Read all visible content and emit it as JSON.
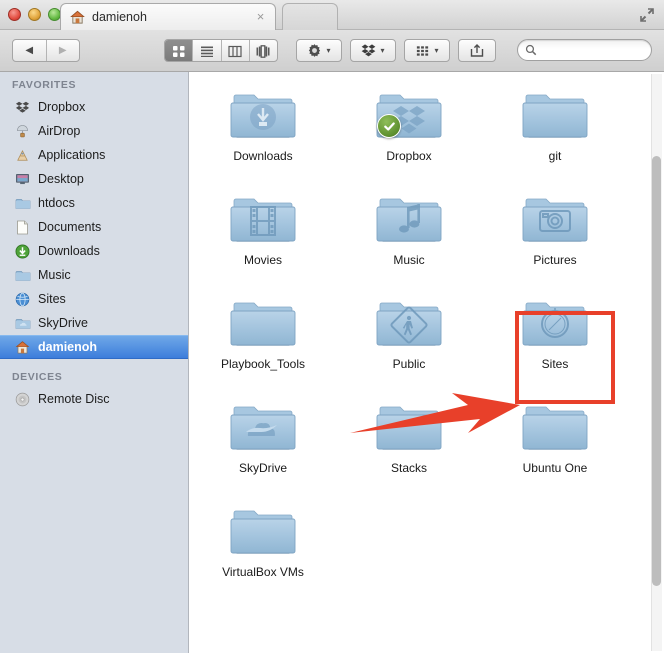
{
  "window": {
    "title": "damienoh",
    "traffic_lights": [
      "close-button",
      "minimize-button",
      "zoom-button"
    ],
    "fullscreen_icon": "fullscreen-icon"
  },
  "tabs": {
    "active": {
      "label": "damienoh",
      "icon": "home-icon",
      "close_icon": "×"
    },
    "new_tab_label": ""
  },
  "toolbar": {
    "back_label": "◀",
    "forward_label": "▶",
    "view_modes": [
      {
        "name": "icon-view",
        "selected": true
      },
      {
        "name": "list-view",
        "selected": false
      },
      {
        "name": "column-view",
        "selected": false
      },
      {
        "name": "coverflow-view",
        "selected": false
      }
    ],
    "action_menu": {
      "icon": "gear-icon",
      "caret": "▾"
    },
    "dropbox_menu": {
      "icon": "dropbox-icon",
      "caret": "▾"
    },
    "arrange_menu": {
      "icon": "arrange-grid-icon",
      "caret": "▾"
    },
    "share_button": {
      "icon": "share-icon"
    },
    "search": {
      "icon": "search-icon",
      "placeholder": "",
      "value": ""
    }
  },
  "sidebar": {
    "sections": [
      {
        "header": "FAVORITES",
        "items": [
          {
            "label": "Dropbox",
            "icon": "dropbox-icon",
            "selected": false
          },
          {
            "label": "AirDrop",
            "icon": "airdrop-icon",
            "selected": false
          },
          {
            "label": "Applications",
            "icon": "applications-icon",
            "selected": false
          },
          {
            "label": "Desktop",
            "icon": "desktop-icon",
            "selected": false
          },
          {
            "label": "htdocs",
            "icon": "folder-icon",
            "selected": false
          },
          {
            "label": "Documents",
            "icon": "document-icon",
            "selected": false
          },
          {
            "label": "Downloads",
            "icon": "downloads-icon",
            "selected": false
          },
          {
            "label": "Music",
            "icon": "folder-icon",
            "selected": false
          },
          {
            "label": "Sites",
            "icon": "globe-icon",
            "selected": false
          },
          {
            "label": "SkyDrive",
            "icon": "folder-icon",
            "selected": false
          },
          {
            "label": "damienoh",
            "icon": "home-icon",
            "selected": true
          }
        ]
      },
      {
        "header": "DEVICES",
        "items": [
          {
            "label": "Remote Disc",
            "icon": "disc-icon",
            "selected": false
          }
        ]
      }
    ]
  },
  "files": [
    {
      "label": "Downloads",
      "emblem": "download-arrow-emblem",
      "badge": null
    },
    {
      "label": "Dropbox",
      "emblem": "dropbox-emblem",
      "badge": "green-check-badge"
    },
    {
      "label": "git",
      "emblem": null,
      "badge": null
    },
    {
      "label": "Movies",
      "emblem": "film-strip-emblem",
      "badge": null
    },
    {
      "label": "Music",
      "emblem": "music-note-emblem",
      "badge": null
    },
    {
      "label": "Pictures",
      "emblem": "camera-emblem",
      "badge": null
    },
    {
      "label": "Playbook_Tools",
      "emblem": null,
      "badge": null
    },
    {
      "label": "Public",
      "emblem": "pedestrian-sign-emblem",
      "badge": null
    },
    {
      "label": "Sites",
      "emblem": "compass-emblem",
      "badge": null
    },
    {
      "label": "SkyDrive",
      "emblem": "cloud-emblem",
      "badge": null
    },
    {
      "label": "Stacks",
      "emblem": null,
      "badge": null
    },
    {
      "label": "Ubuntu One",
      "emblem": null,
      "badge": null
    },
    {
      "label": "VirtualBox VMs",
      "emblem": null,
      "badge": null
    }
  ],
  "annotations": {
    "highlight_color": "#e8402a",
    "highlight_target": "Sites",
    "arrow_color": "#e8402a"
  },
  "colors": {
    "sidebar_bg": "#d7dde6",
    "selection_blue": "#3d7ddb",
    "folder_blue": "#8fb5d2",
    "content_bg": "#ffffff"
  }
}
